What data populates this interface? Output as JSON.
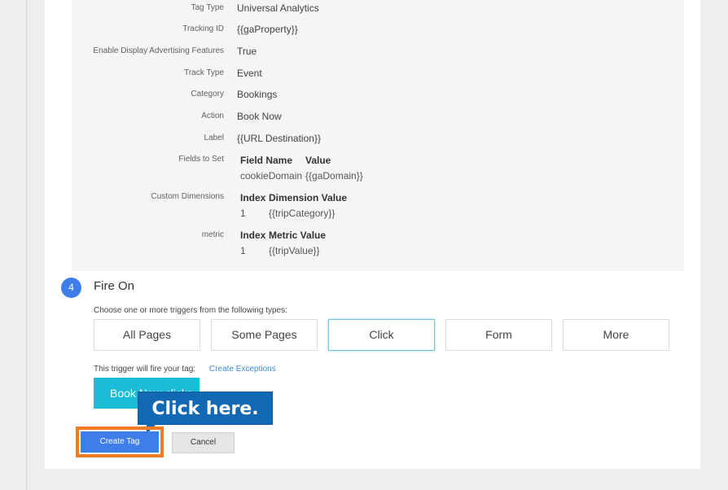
{
  "summary": {
    "rows": [
      {
        "label": "Tag Type",
        "value": "Universal Analytics"
      },
      {
        "label": "Tracking ID",
        "value": "{{gaProperty}}"
      },
      {
        "label": "Enable Display Advertising Features",
        "value": "True"
      },
      {
        "label": "Track Type",
        "value": "Event"
      },
      {
        "label": "Category",
        "value": "Bookings"
      },
      {
        "label": "Action",
        "value": "Book Now"
      },
      {
        "label": "Label",
        "value": "{{URL Destination}}"
      }
    ],
    "fields_to_set": {
      "label": "Fields to Set",
      "headers": [
        "Field Name",
        "Value"
      ],
      "row": [
        "cookieDomain",
        "{{gaDomain}}"
      ]
    },
    "custom_dimensions": {
      "label": "Custom Dimensions",
      "headers": [
        "Index",
        "Dimension Value"
      ],
      "row": [
        "1",
        "{{tripCategory}}"
      ]
    },
    "metric": {
      "label": "metric",
      "headers": [
        "Index",
        "Metric Value"
      ],
      "row": [
        "1",
        "{{tripValue}}"
      ]
    }
  },
  "step": {
    "number": "4",
    "title": "Fire On",
    "choose_text": "Choose one or more triggers from the following types:",
    "trigger_types": [
      "All Pages",
      "Some Pages",
      "Click",
      "Form",
      "More"
    ],
    "selected_trigger": "Click",
    "fire_text": "This trigger will fire your tag:",
    "exceptions_link": "Create Exceptions",
    "trigger_chip": "Book Now clicks"
  },
  "callout": {
    "text": "Click here."
  },
  "actions": {
    "create": "Create Tag",
    "cancel": "Cancel"
  },
  "colors": {
    "accent": "#3f7ee8",
    "chip": "#1bbcd6",
    "callout": "#1268b3",
    "highlight": "#f07b24"
  }
}
